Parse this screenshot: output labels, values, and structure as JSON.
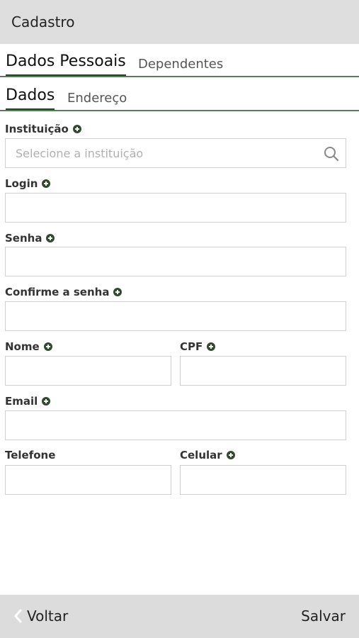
{
  "header": {
    "title": "Cadastro"
  },
  "tabs": {
    "primary": "Dados Pessoais",
    "secondary": "Dependentes"
  },
  "subtabs": {
    "primary": "Dados",
    "secondary": "Endereço"
  },
  "form": {
    "instituicao": {
      "label": "Instituição",
      "placeholder": "Selecione a instituição",
      "required": true
    },
    "login": {
      "label": "Login",
      "required": true
    },
    "senha": {
      "label": "Senha",
      "required": true
    },
    "confirme": {
      "label": "Confirme a senha",
      "required": true
    },
    "nome": {
      "label": "Nome",
      "required": true
    },
    "cpf": {
      "label": "CPF",
      "required": true
    },
    "email": {
      "label": "Email",
      "required": true
    },
    "telefone": {
      "label": "Telefone",
      "required": false
    },
    "celular": {
      "label": "Celular",
      "required": true
    }
  },
  "footer": {
    "back_label": "Voltar",
    "save_label": "Salvar"
  },
  "colors": {
    "accent": "#1e4620",
    "header_bg": "#dedede",
    "footer_bg": "#dcdcdc",
    "required_icon": "#2f4a2f"
  },
  "icons": {
    "required": "plus-circle-icon",
    "search": "search-icon",
    "back": "chevron-left-icon"
  }
}
